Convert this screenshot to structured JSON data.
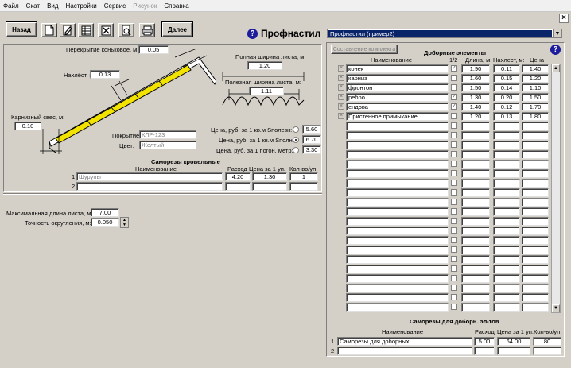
{
  "menu": [
    "Файл",
    "Скат",
    "Вид",
    "Настройки",
    "Сервис",
    "Рисунок",
    "Справка"
  ],
  "toolbar": {
    "back_label": "Назад",
    "next_label": "Далее"
  },
  "header": {
    "title": "Профнастил",
    "help": "?"
  },
  "product_select": {
    "value": "Профнастил (пример2)"
  },
  "left": {
    "ridge_overlap_label": "Перекрытие коньковое, м:",
    "ridge_overlap": "0.05",
    "overlap_label": "Нахлёст, м:",
    "overlap": "0.13",
    "eave_label": "Карнизный свес, м:",
    "eave": "0.10",
    "full_width_label": "Полная ширина листа, м:",
    "full_width": "1.20",
    "useful_width_label": "Полезная ширина листа, м:",
    "useful_width": "1.11",
    "coating_label": "Покрытие:",
    "coating": "КЛР-123",
    "color_label": "Цвет:",
    "color": "Желтый",
    "price_useful_label": "Цена, руб. за 1 кв.м Sполезн:",
    "price_useful": "5.60",
    "price_full_label": "Цена, руб. за 1 кв.м Sполн:",
    "price_full": "6.70",
    "price_linear_label": "Цена, руб. за 1 погон. метр:",
    "price_linear": "3.30",
    "screws_title": "Саморезы кровельные",
    "screws_headers": [
      "Наименование",
      "Расход",
      "Цена за 1 уп.",
      "Кол-во/уп."
    ],
    "screws_rows": [
      {
        "num": "1",
        "name": "Шурупы",
        "usage": "4.20",
        "price": "1.30",
        "qty": "1"
      },
      {
        "num": "2",
        "name": "",
        "usage": "",
        "price": "",
        "qty": ""
      }
    ],
    "max_len_label": "Максимальная длина листа, м:",
    "max_len": "7.00",
    "round_label": "Точность округления, м:",
    "round": "0.050"
  },
  "right": {
    "compose_button": "Составление комплекта",
    "title": "Доборные элементы",
    "headers": [
      "Наименование",
      "1/2",
      "Длина, м:",
      "Нахлест, м:",
      "Цена"
    ],
    "rows": [
      {
        "name": "конек",
        "half": "✓",
        "len": "1.90",
        "lap": "0.11",
        "price": "1.40"
      },
      {
        "name": "карниз",
        "half": "",
        "len": "1.60",
        "lap": "0.15",
        "price": "1.20"
      },
      {
        "name": "фронтон",
        "half": "",
        "len": "1.50",
        "lap": "0.14",
        "price": "1.10"
      },
      {
        "name": "ребро",
        "half": "✓",
        "len": "1.30",
        "lap": "0.20",
        "price": "1.50"
      },
      {
        "name": "ендова",
        "half": "✓",
        "len": "1.40",
        "lap": "0.12",
        "price": "1.70"
      },
      {
        "name": "Пристенное примыкание",
        "half": "",
        "len": "1.20",
        "lap": "0.13",
        "price": "1.80"
      }
    ],
    "screws_title": "Саморезы для доборн. эл-тов",
    "screws_headers": [
      "Наименование",
      "Расход",
      "Цена за 1 уп.",
      "Кол-во/уп."
    ],
    "screws_rows": [
      {
        "num": "1",
        "name": "Саморезы для доборных",
        "usage": "5.00",
        "price": "64.00",
        "qty": "80"
      },
      {
        "num": "2",
        "name": "",
        "usage": "",
        "price": "",
        "qty": ""
      }
    ]
  }
}
